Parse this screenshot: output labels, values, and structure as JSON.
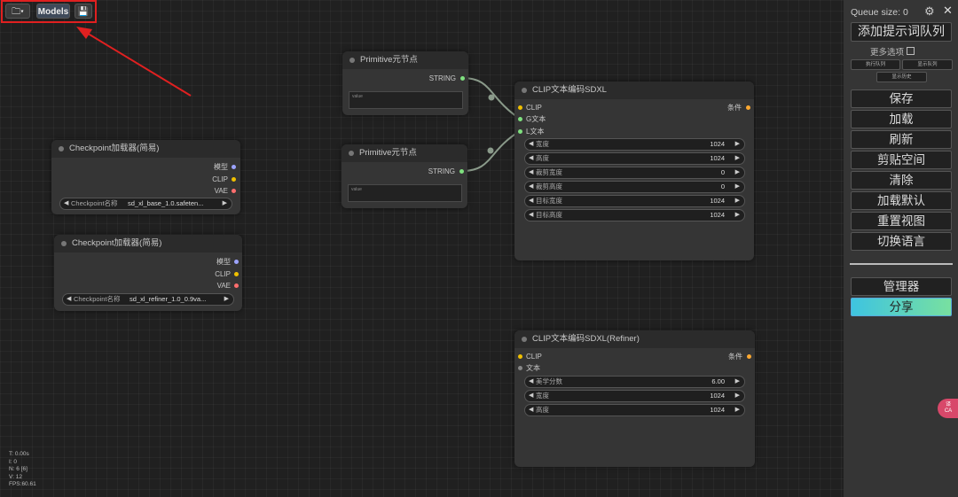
{
  "toolbar": {
    "folder_label": "🗀▾",
    "models_label": "Models",
    "save_label": "💾"
  },
  "nodes": {
    "primitive1": {
      "title": "Primitive元节点",
      "output": "STRING",
      "textbox_placeholder": "value"
    },
    "primitive2": {
      "title": "Primitive元节点",
      "output": "STRING",
      "textbox_placeholder": "value"
    },
    "checkpoint1": {
      "title": "Checkpoint加载器(简易)",
      "outputs": [
        "模型",
        "CLIP",
        "VAE"
      ],
      "widget_label": "Checkpoint名称",
      "widget_value": "sd_xl_base_1.0.safeten..."
    },
    "checkpoint2": {
      "title": "Checkpoint加载器(简易)",
      "outputs": [
        "模型",
        "CLIP",
        "VAE"
      ],
      "widget_label": "Checkpoint名称",
      "widget_value": "sd_xl_refiner_1.0_0.9va..."
    },
    "clip_sdxl": {
      "title": "CLIP文本编码SDXL",
      "inputs": [
        "CLIP",
        "G文本",
        "L文本"
      ],
      "output": "条件",
      "widgets": [
        {
          "label": "宽度",
          "value": "1024"
        },
        {
          "label": "高度",
          "value": "1024"
        },
        {
          "label": "裁剪宽度",
          "value": "0"
        },
        {
          "label": "裁剪高度",
          "value": "0"
        },
        {
          "label": "目标宽度",
          "value": "1024"
        },
        {
          "label": "目标高度",
          "value": "1024"
        }
      ]
    },
    "clip_refiner": {
      "title": "CLIP文本编码SDXL(Refiner)",
      "inputs": [
        "CLIP",
        "文本"
      ],
      "output": "条件",
      "widgets": [
        {
          "label": "美学分数",
          "value": "6.00"
        },
        {
          "label": "宽度",
          "value": "1024"
        },
        {
          "label": "高度",
          "value": "1024"
        }
      ]
    }
  },
  "stats": [
    "T: 0.00s",
    "I: 0",
    "N: 6 [6]",
    "V: 12",
    "FPS:60.61"
  ],
  "panel": {
    "queue_size": "Queue size: 0",
    "gear_icon": "⚙",
    "close_icon": "✕",
    "queue_prompt": "添加提示词队列",
    "more_options": "更多选项",
    "run_queue": "执行队列",
    "view_queue": "显示队列",
    "view_history": "显示历史",
    "save": "保存",
    "load": "加载",
    "refresh": "刷新",
    "clipspace": "剪贴空间",
    "clear": "清除",
    "load_default": "加载默认",
    "reset_view": "重置视图",
    "switch_language": "切换语言",
    "manager": "管理器",
    "share": "分享"
  },
  "lang_badge": "译\nCA",
  "colors": {
    "clip": "#f0c000",
    "model": "#9da4ff",
    "vae": "#ff6e6e",
    "string": "#7fe07f",
    "conditioning": "#ffa931",
    "highlight": "#e02020"
  }
}
